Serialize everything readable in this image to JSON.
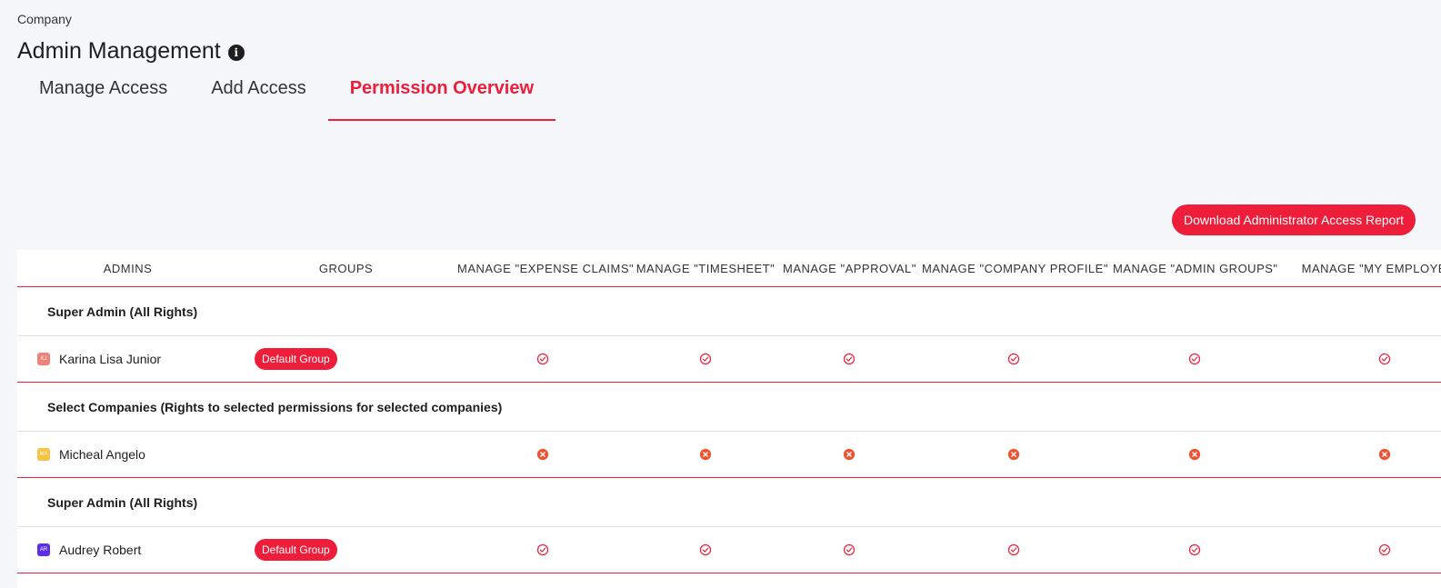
{
  "breadcrumb": "Company",
  "page_title": "Admin Management",
  "tabs": [
    {
      "label": "Manage Access"
    },
    {
      "label": "Add Access"
    },
    {
      "label": "Permission Overview"
    }
  ],
  "download_button": "Download Administrator Access Report",
  "table": {
    "headers": [
      "ADMINS",
      "GROUPS",
      "MANAGE \"EXPENSE CLAIMS\"",
      "MANAGE \"TIMESHEET\"",
      "MANAGE \"APPROVAL\"",
      "MANAGE \"COMPANY PROFILE\"",
      "MANAGE \"ADMIN GROUPS\"",
      "MANAGE \"MY EMPLOYEES\""
    ],
    "sections": [
      {
        "label": "Super Admin (All Rights)"
      },
      {
        "label": "Select Companies (Rights to selected permissions for selected companies)"
      },
      {
        "label": "Super Admin (All Rights)"
      }
    ],
    "rows": [
      {
        "initials": "KJ",
        "avatar_color": "#f0827a",
        "name": "Karina Lisa Junior",
        "group": "Default Group",
        "permission": "allowed"
      },
      {
        "initials": "MA",
        "avatar_color": "#f7c23e",
        "name": "Micheal Angelo",
        "group": "",
        "permission": "denied"
      },
      {
        "initials": "AR",
        "avatar_color": "#5b2ee8",
        "name": "Audrey Robert",
        "group": "Default Group",
        "permission": "allowed"
      }
    ]
  },
  "colors": {
    "accent": "#ee1d3a",
    "allowed": "#ee1d3a",
    "denied": "#f0522f"
  },
  "icons": {
    "info": "info-icon",
    "allowed": "check-circle-icon",
    "denied": "x-circle-icon"
  }
}
